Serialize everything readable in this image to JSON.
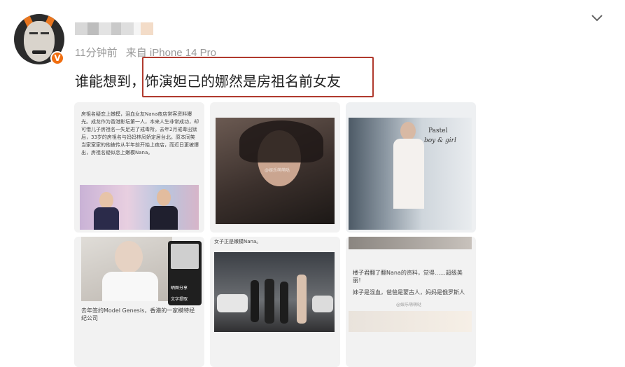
{
  "post": {
    "timestamp": "11分钟前",
    "source": "来自 iPhone 14 Pro",
    "text_prefix": "谁能想到，",
    "text_highlight": "饰演妲己的娜然是房祖名前女友",
    "verified_badge": "V"
  },
  "images": {
    "tile1_text": "房祖名疑恋上嫩模，泪血女友Nana夜店常客资料曝光。成龙作为香港影坛第一人，本来人生非常成功，却可惜儿子房祖名一失足进了戒毒所。去年2月戒毒出狱后，33岁的房祖名与妈妈林凤娇定居台北。原本同笑当家室家的他被传从半年前开始上夜店，而近日更被爆出，房祖名疑似恋上嫩模Nana。",
    "tile2_watermark": "@娱乐萌萌哒",
    "tile3_title_1": "Pastel",
    "tile3_title_2": "boy & girl",
    "tile4_caption": "去年签约Model Genesis，香港的一家模特经纪公司",
    "tile4_share": "晒图分享",
    "tile4_text": "文字提取",
    "tile5_caption": "女子正是嫩模Nana。",
    "tile6_text_1": "楼子君翻了翻Nana的资料，觉得……超级美丽！",
    "tile6_text_2": "妹子是混血，爸爸是蒙古人，妈妈是俄罗斯人",
    "tile6_watermark": "@娱乐萌萌哒"
  },
  "icons": {
    "chevron": "chevron-down-icon",
    "verified": "verified-badge-icon"
  },
  "colors": {
    "highlight_border": "#b03a2e",
    "verified": "#f06e10",
    "meta_text": "#999999"
  }
}
